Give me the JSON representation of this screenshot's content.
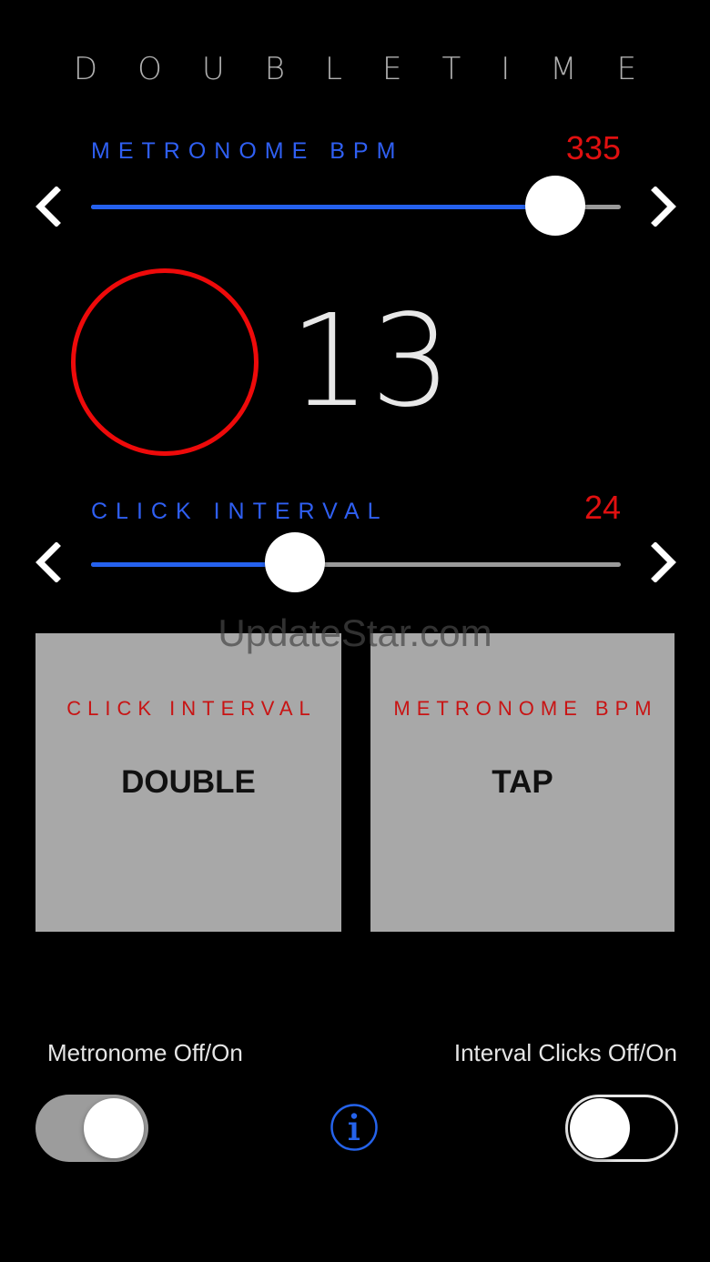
{
  "app": {
    "title": "DOUBLETIME"
  },
  "bpm_slider": {
    "label": "METRONOME BPM",
    "value": "335",
    "level": 0.877
  },
  "beat": {
    "count": "13"
  },
  "interval_slider": {
    "label": "CLICK INTERVAL",
    "value": "24",
    "level": 0.385
  },
  "buttons": {
    "double": {
      "sub": "CLICK INTERVAL",
      "label": "DOUBLE"
    },
    "tap": {
      "sub": "METRONOME BPM",
      "label": "TAP"
    }
  },
  "watermark": "UpdateStar.com",
  "toggles": {
    "metronome": {
      "label": "Metronome Off/On",
      "state": "on"
    },
    "interval_clicks": {
      "label": "Interval Clicks Off/On",
      "state": "off"
    }
  },
  "icons": {
    "prev": "chevron-left-icon",
    "next": "chevron-right-icon",
    "info": "info-icon"
  },
  "colors": {
    "accent_blue": "#2f5ff2",
    "value_red": "#e01010",
    "beat_ring": "#ee0a0a",
    "button_gray": "#a8a8a8"
  }
}
